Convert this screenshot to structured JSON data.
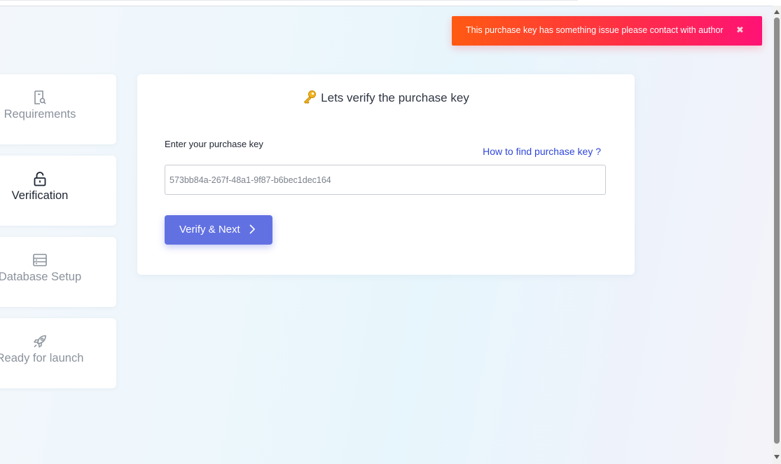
{
  "steps": [
    {
      "label": "Requirements",
      "icon": "document-search-icon",
      "active": false
    },
    {
      "label": "Verification",
      "icon": "unlock-icon",
      "active": true
    },
    {
      "label": "Database Setup",
      "icon": "database-table-icon",
      "active": false
    },
    {
      "label": "Ready for launch",
      "icon": "rocket-icon",
      "active": false
    }
  ],
  "card": {
    "title": "Lets verify the purchase key",
    "title_icon": "key-icon",
    "field_label": "Enter your purchase key",
    "help_link": "How to find purchase key ?",
    "key_value": "573bb84a-267f-48a1-9f87-b6bec1dec164",
    "button_label": "Verify & Next",
    "button_icon": "chevron-right-icon"
  },
  "toast": {
    "message": "This purchase key has something issue please contact with author",
    "close_glyph": "✖",
    "close_icon": "close-icon"
  },
  "colors": {
    "accent": "#6271e2",
    "link": "#2f46d8",
    "toast_start": "#ff5a12",
    "toast_end": "#ff1275",
    "active_text": "#1d2433",
    "inactive_text": "#8b929c"
  }
}
